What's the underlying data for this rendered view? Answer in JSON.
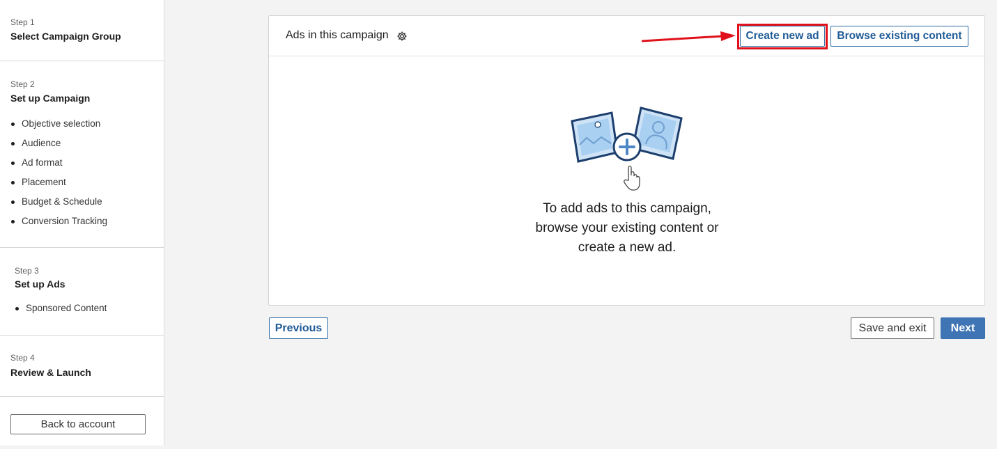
{
  "sidebar": {
    "step1": {
      "num": "Step 1",
      "title": "Select Campaign Group"
    },
    "step2": {
      "num": "Step 2",
      "title": "Set up Campaign",
      "items": [
        "Objective selection",
        "Audience",
        "Ad format",
        "Placement",
        "Budget & Schedule",
        "Conversion Tracking"
      ]
    },
    "step3": {
      "num": "Step 3",
      "title": "Set up Ads",
      "items": [
        "Sponsored Content"
      ]
    },
    "step4": {
      "num": "Step 4",
      "title": "Review & Launch"
    },
    "back_label": "Back to account"
  },
  "card": {
    "title": "Ads in this campaign",
    "create_label": "Create new ad",
    "browse_label": "Browse existing content",
    "empty_lines": [
      "To add ads to this campaign,",
      "browse your existing content or",
      "create a new ad."
    ]
  },
  "footer": {
    "previous_label": "Previous",
    "save_exit_label": "Save and exit",
    "next_label": "Next"
  },
  "colors": {
    "accent": "#1f5b96",
    "primary_button": "#3f74b5",
    "annotation": "#e0111b"
  },
  "icons": [
    "gear-icon",
    "image-icon",
    "person-icon",
    "plus-icon",
    "hand-pointer-icon",
    "arrow-icon"
  ]
}
